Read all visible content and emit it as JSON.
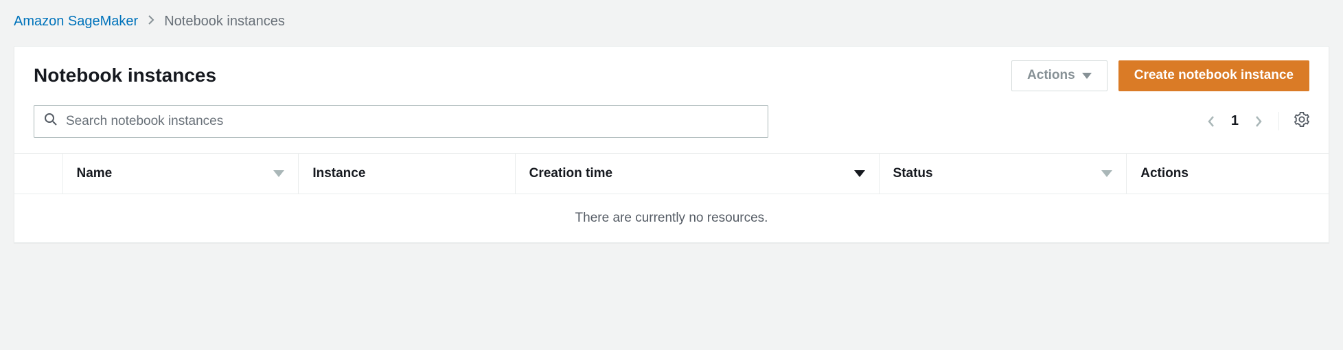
{
  "breadcrumb": {
    "root": "Amazon SageMaker",
    "current": "Notebook instances"
  },
  "header": {
    "title": "Notebook instances",
    "actions_label": "Actions",
    "create_label": "Create notebook instance"
  },
  "search": {
    "placeholder": "Search notebook instances"
  },
  "pagination": {
    "page": "1"
  },
  "table": {
    "columns": {
      "name": "Name",
      "instance": "Instance",
      "creation_time": "Creation time",
      "status": "Status",
      "actions": "Actions"
    },
    "empty_message": "There are currently no resources."
  }
}
